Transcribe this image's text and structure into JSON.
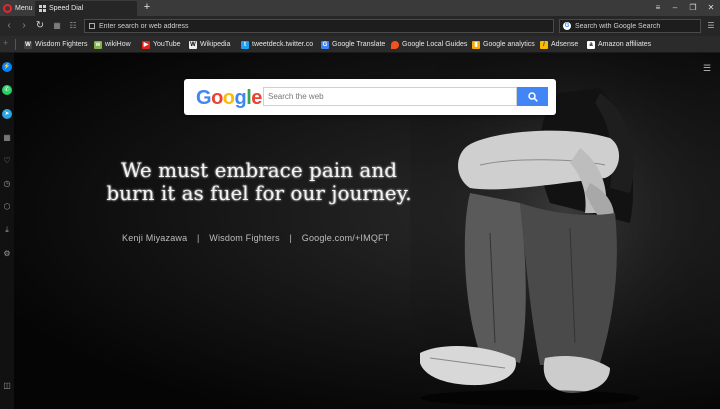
{
  "titlebar": {
    "menu_label": "Menu",
    "tab_label": "Speed Dial",
    "new_tab": "+"
  },
  "nav": {
    "address_placeholder": "Enter search or web address",
    "search_placeholder": "Search with Google Search"
  },
  "bookmarks": [
    {
      "label": "Wisdom Fighters",
      "icon": "wisdom-fighters-icon",
      "color": "#444444"
    },
    {
      "label": "wikiHow",
      "icon": "wikihow-icon",
      "color": "#7fb24b"
    },
    {
      "label": "YouTube",
      "icon": "youtube-icon",
      "color": "#e62117"
    },
    {
      "label": "Wikipedia",
      "icon": "wikipedia-icon",
      "color": "#eeeeee"
    },
    {
      "label": "tweetdeck.twitter.co",
      "icon": "twitter-icon",
      "color": "#1da1f2"
    },
    {
      "label": "Google Translate",
      "icon": "google-translate-icon",
      "color": "#4285f4"
    },
    {
      "label": "Google Local Guides",
      "icon": "local-guides-icon",
      "color": "#f4511e"
    },
    {
      "label": "Google analytics",
      "icon": "analytics-icon",
      "color": "#f9ab00"
    },
    {
      "label": "Adsense",
      "icon": "adsense-icon",
      "color": "#fbbc04"
    },
    {
      "label": "Amazon affiliates",
      "icon": "amazon-icon",
      "color": "#ffffff"
    }
  ],
  "speed_dial": {
    "logo_text": "Google",
    "search_placeholder": "Search the web"
  },
  "wallpaper": {
    "quote_line1": "We must embrace pain and",
    "quote_line2": "burn it as fuel for our journey.",
    "credit_author": "Kenji Miyazawa",
    "credit_site": "Wisdom Fighters",
    "credit_url": "Google.com/+IMQFT",
    "credit_separator": "|"
  },
  "sidebar_icons": [
    "messenger-icon",
    "whatsapp-icon",
    "telegram-icon",
    "speed-dial-icon",
    "heart-icon",
    "history-icon",
    "extensions-icon",
    "downloads-icon",
    "settings-icon",
    "sidebar-toggle-icon"
  ],
  "colors": {
    "accent_red": "#e8262b",
    "google_blue": "#4285f4",
    "messenger": "#0084ff",
    "whatsapp": "#25d366",
    "telegram": "#2ca5e0"
  }
}
